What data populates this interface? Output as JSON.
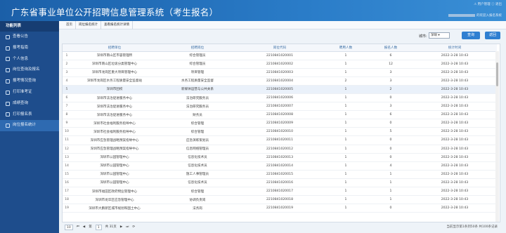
{
  "app": {
    "title": "广东省事业单位公开招聘信息管理系统（考生报名）",
    "user_links": "⚠ 用户管理 ⓘ 退出",
    "user_line": "的欢迎入报名系统"
  },
  "sidebar": {
    "header": "功能列表",
    "items": [
      {
        "label": "查看公告",
        "icon": "document-icon"
      },
      {
        "label": "报考指南",
        "icon": "guide-icon"
      },
      {
        "label": "个人信息",
        "icon": "user-icon"
      },
      {
        "label": "岗位查询及报名",
        "icon": "search-icon"
      },
      {
        "label": "报考情况查询",
        "icon": "list-icon"
      },
      {
        "label": "打印准考证",
        "icon": "print-icon"
      },
      {
        "label": "成绩查询",
        "icon": "score-icon"
      },
      {
        "label": "打印报名表",
        "icon": "print-icon"
      },
      {
        "label": "岗位报名统计",
        "icon": "chart-icon"
      }
    ],
    "active_index": 8
  },
  "breadcrumb": {
    "tabs": [
      "首页",
      "岗位报名统计",
      "查看报名统计详情"
    ]
  },
  "toolbar": {
    "city_label": "城市:",
    "city_value": "深圳",
    "query_label": "查询",
    "back_label": "返回"
  },
  "table": {
    "headers": [
      "",
      "招聘单位",
      "招聘岗位",
      "岗位代码",
      "聘用人数",
      "报名人数",
      "统计时间"
    ],
    "rows": [
      [
        "1",
        "深圳市南山区市容管理所",
        "综合管理员",
        "2210841020001",
        "1",
        "6",
        "2022-3-28 10:43"
      ],
      [
        "2",
        "深圳市南山区垃圾分类管理中心",
        "综合管理员",
        "2210841020002",
        "1",
        "12",
        "2022-3-28 10:43"
      ],
      [
        "3",
        "深圳市龙岗区重大项目管理中心",
        "项目管理",
        "2210841020003",
        "1",
        "3",
        "2022-3-28 10:43"
      ],
      [
        "4",
        "深圳市龙岗区水务工程质量安全监督站",
        "水务工程质量安全监督",
        "2210841020004",
        "2",
        "3",
        "2022-3-28 10:43"
      ],
      [
        "5",
        "深圳市团校",
        "新媒体运营与公共关系",
        "2210841020005",
        "1",
        "2",
        "2022-3-28 10:43"
      ],
      [
        "6",
        "深圳市法治促进服务中心",
        "法治研究服务员",
        "2210841020006",
        "1",
        "0",
        "2022-3-28 10:43"
      ],
      [
        "7",
        "深圳市法治促进服务中心",
        "法治研究服务员",
        "2210841020007",
        "1",
        "3",
        "2022-3-28 10:43"
      ],
      [
        "8",
        "深圳市法治促进服务中心",
        "财务员",
        "2210841020008",
        "1",
        "6",
        "2022-3-28 10:43"
      ],
      [
        "9",
        "深圳市社会福利服务指导中心",
        "综合管理",
        "2210841020009",
        "1",
        "0",
        "2022-3-28 10:43"
      ],
      [
        "10",
        "深圳市社会福利服务指导中心",
        "综合管理",
        "2210841020010",
        "1",
        "5",
        "2022-3-28 10:43"
      ],
      [
        "11",
        "深圳市应急管理战略预案指导中心",
        "应急演练策划员",
        "2210841020011",
        "1",
        "0",
        "2022-3-28 10:43"
      ],
      [
        "12",
        "深圳市应急管理战略预案指导中心",
        "信息网络管理员",
        "2210841020012",
        "1",
        "0",
        "2022-3-28 10:43"
      ],
      [
        "13",
        "深圳市公园管理中心",
        "信息化技术员",
        "2210841020013",
        "1",
        "0",
        "2022-3-28 10:43"
      ],
      [
        "14",
        "深圳市公园管理中心",
        "信息化技术员",
        "2210841020014",
        "1",
        "4",
        "2022-3-28 10:43"
      ],
      [
        "15",
        "深圳市公园管理中心",
        "施工人事管理员",
        "2210841020015",
        "1",
        "1",
        "2022-3-28 10:43"
      ],
      [
        "16",
        "深圳市公园管理中心",
        "信息化技术员",
        "2210841020016",
        "1",
        "1",
        "2022-3-28 10:43"
      ],
      [
        "17",
        "深圳市福田区政府物业管理中心",
        "综合管理",
        "2210841020017",
        "1",
        "1",
        "2022-3-28 10:43"
      ],
      [
        "18",
        "深圳市龙华区应急管理中心",
        "协调负责岗",
        "2210841020018",
        "1",
        "1",
        "2022-3-28 10:43"
      ],
      [
        "19",
        "深圳市大鹏新区城市规划和国土中心",
        "法务岗",
        "2210841020019",
        "1",
        "0",
        "2022-3-28 10:43"
      ]
    ],
    "highlight_row": 4
  },
  "pager": {
    "page_size": "10",
    "first": "⏮",
    "prev": "◀",
    "page_label": "第",
    "page_value": "1",
    "total_pages": "共 31页",
    "next": "▶",
    "last": "⏭",
    "refresh": "⟳",
    "summary": "当前显示第1条到50条 共100条记录"
  },
  "colors": {
    "header_blue": "#1b5fa8",
    "sidebar_blue": "#1e4d8c",
    "button_blue": "#2f7fd1"
  }
}
